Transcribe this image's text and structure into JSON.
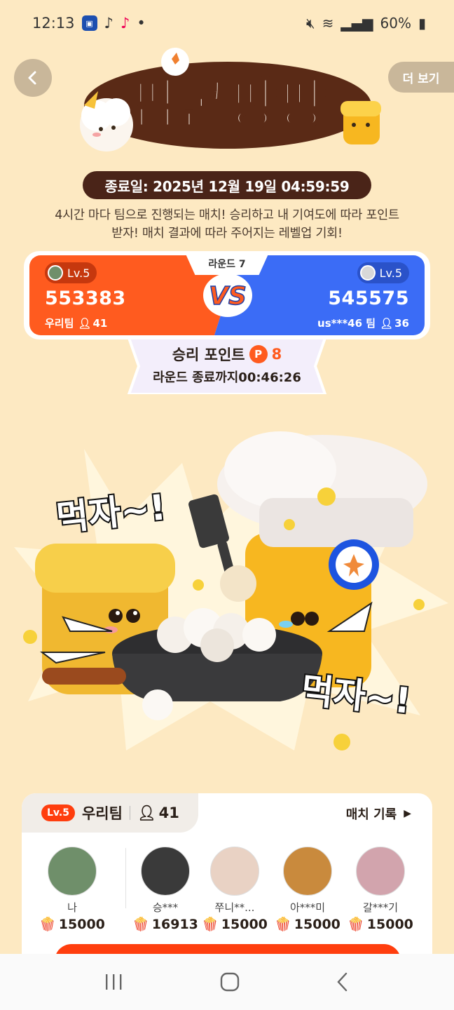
{
  "status_bar": {
    "time": "12:13",
    "battery": "60%"
  },
  "header": {
    "more_label": "더 보기",
    "logo_text": "팝콘팡팡"
  },
  "event": {
    "end_date": "종료일: 2025년 12월 19일 04:59:59",
    "desc_line1": "4시간 마다 팀으로 진행되는 매치! 승리하고 내 기여도에 따라 포인트",
    "desc_line2": "받자! 매치 결과에 따라 주어지는 레벨업 기회!"
  },
  "match": {
    "round_label": "라운드 7",
    "vs_text": "VS",
    "left": {
      "level": "Lv.5",
      "score": "553383",
      "team_name": "우리팀",
      "members": "41",
      "color": "#ff5b1f"
    },
    "right": {
      "level": "Lv.5",
      "score": "545575",
      "team_name": "us***46 팀",
      "members": "36",
      "color": "#3b6cf6"
    },
    "win_label": "승리 포인트",
    "win_points": "8",
    "coin_symbol": "P",
    "timer": "라운드 종료까지00:46:26"
  },
  "illustration": {
    "shout_1": "먹자~!",
    "shout_2": "먹자~!"
  },
  "team_panel": {
    "level_badge": "Lv.5",
    "team_name": "우리팀",
    "member_count": "41",
    "match_record_label": "매치 기록",
    "members": [
      {
        "name": "나",
        "points": "15000",
        "avatar_color": "#6f8f6a"
      },
      {
        "name": "승***",
        "points": "16913",
        "avatar_color": "#3a3a3a"
      },
      {
        "name": "쭈니**...",
        "points": "15000",
        "avatar_color": "#e9d2c4"
      },
      {
        "name": "아***미",
        "points": "15000",
        "avatar_color": "#c98a3d"
      },
      {
        "name": "갈***기",
        "points": "15000",
        "avatar_color": "#d2a4ad"
      }
    ]
  },
  "colors": {
    "background": "#fde9c2",
    "accent": "#ff3e0e",
    "dark_brown": "#4a2418"
  }
}
